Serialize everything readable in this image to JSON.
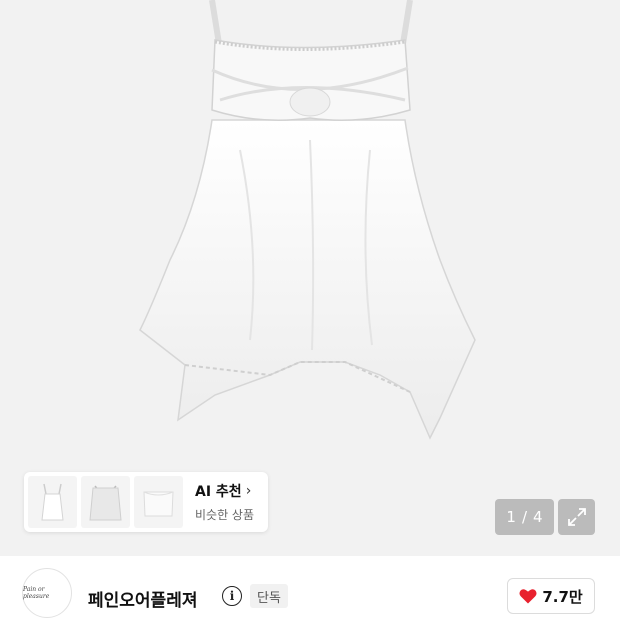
{
  "gallery": {
    "ai_recommend": {
      "title": "AI 추천",
      "chevron": "›",
      "subtitle": "비슷한 상품",
      "thumbnails": [
        "thumb-1",
        "thumb-2",
        "thumb-3"
      ]
    },
    "pager": {
      "current": "1",
      "separator": "/",
      "total": "4"
    },
    "expand_icon": "expand-icon"
  },
  "brand": {
    "name": "페인오어플레져",
    "logo_text": "Pain or pleasure",
    "info_icon": "i",
    "badge": "단독"
  },
  "like": {
    "icon": "heart-icon",
    "count": "7.7만",
    "color": "#e8212e"
  }
}
